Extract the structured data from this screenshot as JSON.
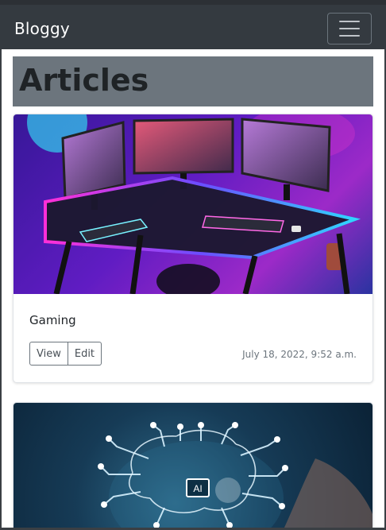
{
  "navbar": {
    "brand": "Bloggy",
    "toggle_icon": "hamburger-menu-icon"
  },
  "page": {
    "heading": "Articles"
  },
  "articles": [
    {
      "title": "Gaming",
      "view_label": "View",
      "edit_label": "Edit",
      "timestamp": "July 18, 2022, 9:52 a.m.",
      "image": "gaming-desk-setup-image"
    },
    {
      "image": "ai-circuit-brain-image",
      "image_text": "AI"
    }
  ],
  "colors": {
    "navbar_bg": "#343a40",
    "heading_bg": "#6c757d",
    "button_border": "#6c757d"
  }
}
